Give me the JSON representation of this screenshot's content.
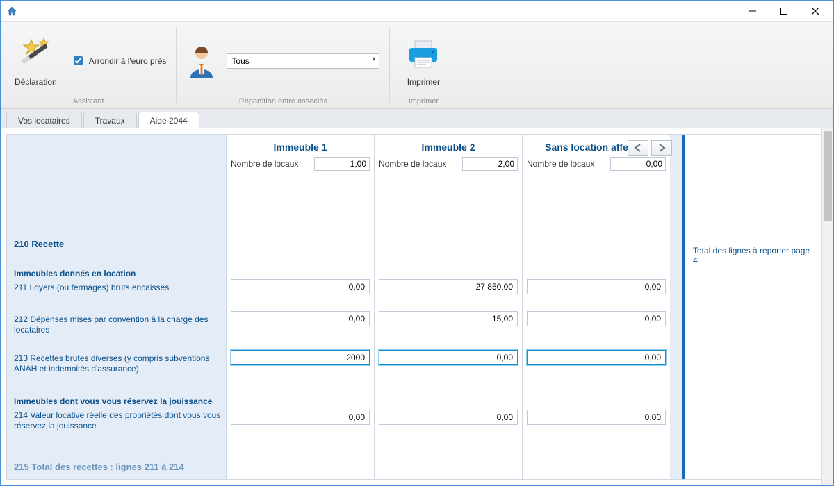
{
  "titlebar": {},
  "ribbon": {
    "declaration": "Déclaration",
    "assistant_group": "Assistant",
    "round_label": "Arrondir à l'euro près",
    "associate_selected": "Tous",
    "repartition_group": "Répartition entre associés",
    "print": "Imprimer",
    "print_group": "Imprimer"
  },
  "tabs": {
    "locataires": "Vos locataires",
    "travaux": "Travaux",
    "aide": "Aide 2044"
  },
  "sheet": {
    "cols": [
      {
        "title": "Immeuble 1",
        "locaux_label": "Nombre de locaux",
        "locaux": "1,00"
      },
      {
        "title": "Immeuble 2",
        "locaux_label": "Nombre de locaux",
        "locaux": "2,00"
      },
      {
        "title": "Sans location affectée",
        "locaux_label": "Nombre de locaux",
        "locaux": "0,00"
      }
    ],
    "section_210": "210 Recette",
    "sub_loc": "Immeubles donnés en location",
    "l211": "211 Loyers (ou fermages) bruts encaissés",
    "l212": "212 Dépenses mises par convention à la charge des locataires",
    "l213": "213 Recettes brutes diverses (y compris subventions ANAH et indemnités d'assurance)",
    "sub_jouissance": "Immeubles dont vous vous réservez la jouissance",
    "l214": "214 Valeur locative réelle des propriétés dont vous vous réservez la jouissance",
    "l215": "215 Total des recettes : lignes 211 à 214",
    "values": {
      "211": [
        "0,00",
        "27 850,00",
        "0,00"
      ],
      "212": [
        "0,00",
        "15,00",
        "0,00"
      ],
      "213": [
        "2000",
        "0,00",
        "0,00"
      ],
      "214": [
        "0,00",
        "0,00",
        "0,00"
      ]
    },
    "right_info": "Total des lignes à reporter page 4"
  }
}
